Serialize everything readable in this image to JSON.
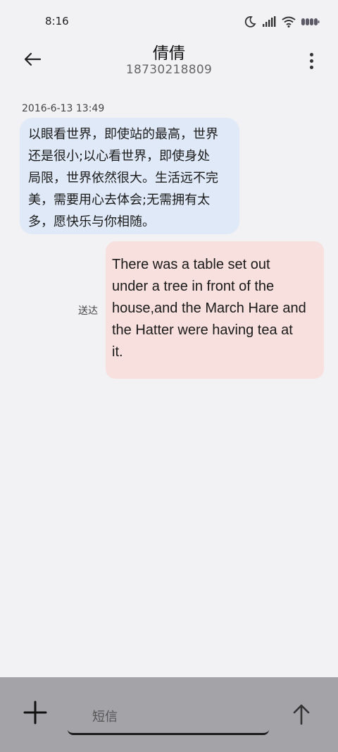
{
  "status_bar": {
    "time": "8:16",
    "icons": [
      "moon-icon",
      "signal-icon",
      "wifi-icon",
      "battery-icon"
    ]
  },
  "header": {
    "contact_name": "倩倩",
    "contact_number": "18730218809",
    "back_icon": "back-arrow-icon",
    "menu_icon": "more-vert-icon"
  },
  "conversation": {
    "timestamp": "2016-6-13 13:49",
    "incoming": {
      "lines": [
        "以眼看世界，即使站的最高，世界",
        "还是很小;以心看世界，即使身处",
        "局限，世界依然很大。生活远不完",
        "美，需要用心去体会;无需拥有太",
        "多，愿快乐与你相随。"
      ]
    },
    "outgoing": {
      "lines": [
        "There was a table set out",
        "under a tree in front of the",
        "house,and the March Hare and",
        "the Hatter were having tea at",
        "it."
      ],
      "status": "送达"
    }
  },
  "compose": {
    "placeholder": "短信",
    "add_icon": "plus-icon",
    "send_icon": "arrow-up-icon"
  },
  "colors": {
    "background": "#f2f2f4",
    "incoming_bubble": "#dfe9f7",
    "outgoing_bubble": "#f7e0dd",
    "compose_bar": "#a4a3a8"
  }
}
